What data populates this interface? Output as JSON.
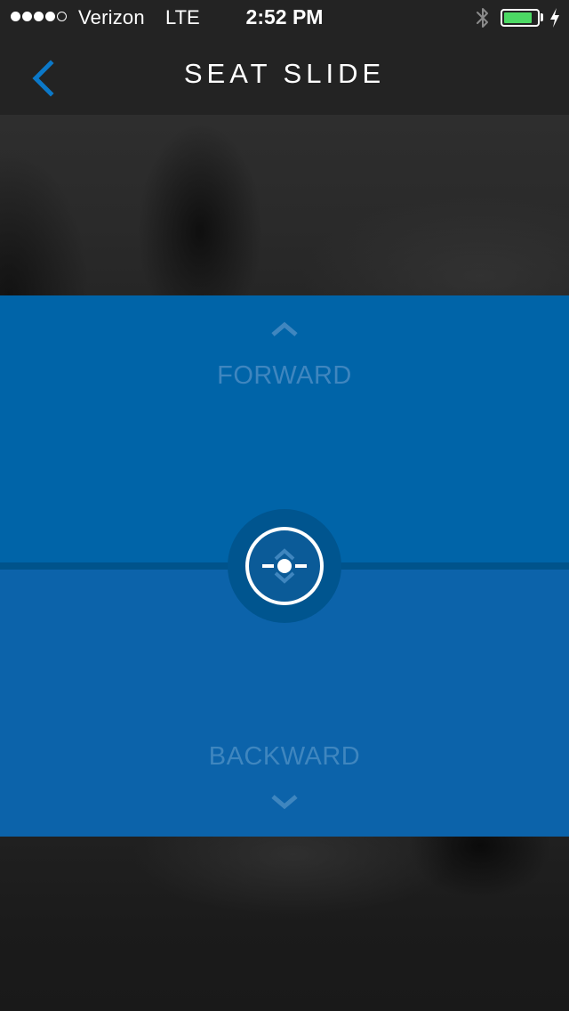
{
  "status_bar": {
    "signal_filled": 4,
    "signal_total": 5,
    "carrier": "Verizon",
    "network": "LTE",
    "time": "2:52 PM",
    "bluetooth_icon": "bluetooth-icon",
    "battery_level": 0.85,
    "battery_color": "#4cd964",
    "charging_icon": "charging-bolt-icon"
  },
  "nav": {
    "back_icon": "chevron-left-icon",
    "title": "SEAT SLIDE",
    "accent": "#0b78c8"
  },
  "control": {
    "forward_label": "FORWARD",
    "forward_icon": "chevron-up-icon",
    "backward_label": "BACKWARD",
    "backward_icon": "chevron-down-icon",
    "knob_icon": "seat-slide-slider-icon",
    "zone_color": "#0064a8",
    "label_color": "#3f86bf"
  }
}
